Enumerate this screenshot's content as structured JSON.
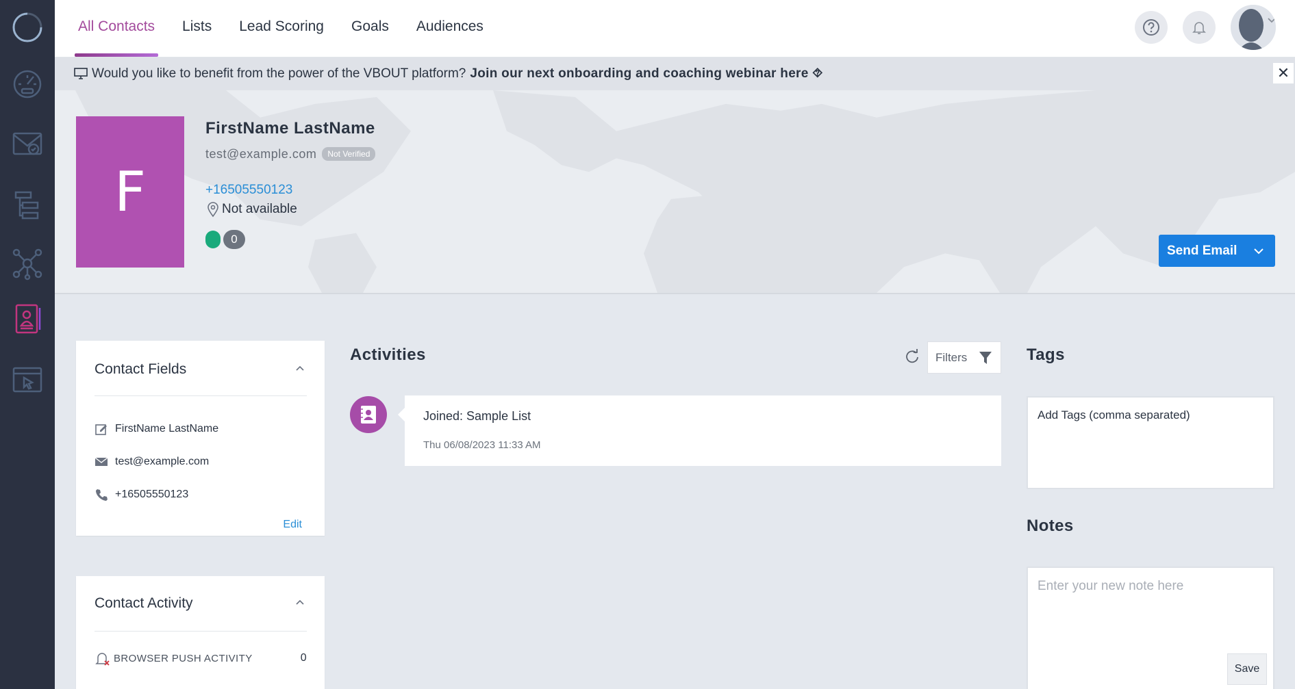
{
  "sidebar": {
    "items": [
      {
        "icon": "logo-ring-icon"
      },
      {
        "icon": "dashboard-gauge-icon"
      },
      {
        "icon": "email-campaign-icon"
      },
      {
        "icon": "workflow-icon"
      },
      {
        "icon": "network-hub-icon"
      },
      {
        "icon": "contacts-icon",
        "active": true
      },
      {
        "icon": "landing-page-icon"
      }
    ]
  },
  "topnav": {
    "tabs": [
      {
        "label": "All Contacts",
        "active": true
      },
      {
        "label": "Lists"
      },
      {
        "label": "Lead Scoring"
      },
      {
        "label": "Goals"
      },
      {
        "label": "Audiences"
      }
    ]
  },
  "banner": {
    "text": "Would you like to benefit from the power of the VBOUT platform?",
    "link": "Join our next onboarding and coaching webinar here ⯑",
    "close": "✕"
  },
  "profile": {
    "initial": "F",
    "name": "FirstName LastName",
    "email": "test@example.com",
    "verify_badge": "Not Verified",
    "phone": "+16505550123",
    "location": "Not available",
    "score_count": "0",
    "send_email_label": "Send Email"
  },
  "contact_fields": {
    "title": "Contact Fields",
    "name": "FirstName LastName",
    "email": "test@example.com",
    "phone": "+16505550123",
    "edit_label": "Edit"
  },
  "contact_activity": {
    "title": "Contact Activity",
    "rows": [
      {
        "label": "BROWSER PUSH ACTIVITY",
        "count": "0"
      }
    ]
  },
  "activities": {
    "title": "Activities",
    "filters_label": "Filters",
    "items": [
      {
        "text": "Joined: Sample List",
        "time": "Thu 06/08/2023 11:33 AM"
      }
    ]
  },
  "tags": {
    "title": "Tags",
    "placeholder": "Add Tags (comma separated)"
  },
  "notes": {
    "title": "Notes",
    "placeholder": "Enter your new note here",
    "save_label": "Save"
  },
  "colors": {
    "accent_purple": "#a34a9c",
    "avatar_bg": "#b051b1",
    "primary_blue": "#1a7fe0",
    "sidebar_bg": "#2b3141"
  }
}
